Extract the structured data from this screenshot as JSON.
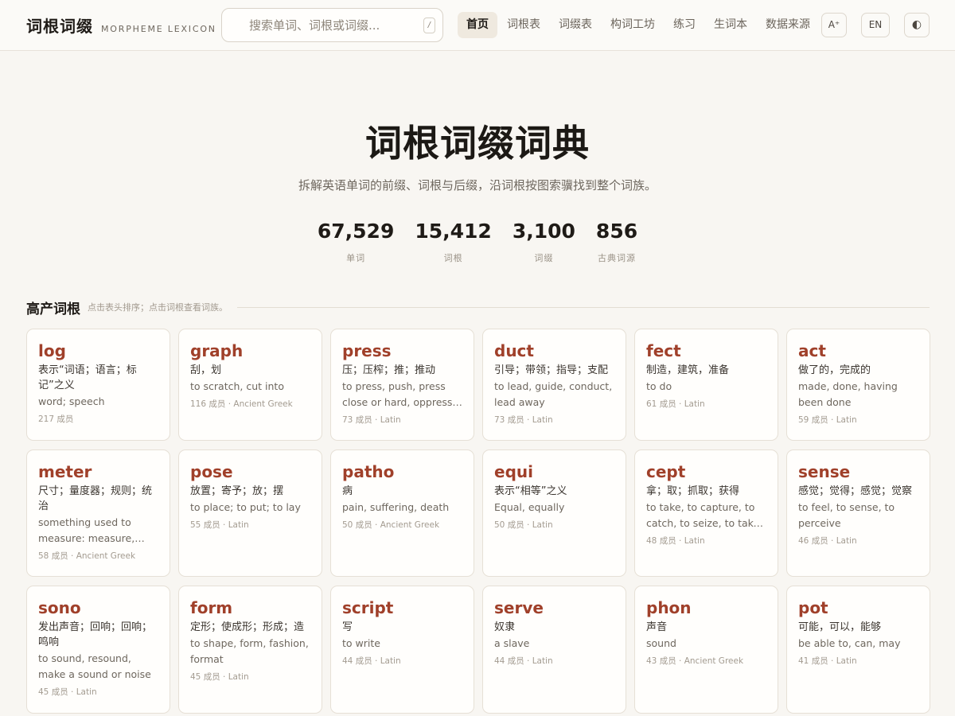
{
  "header": {
    "brand_cn": "词根词缀",
    "brand_en": "MORPHEME LEXICON",
    "search_placeholder": "搜索单词、词根或词缀...",
    "search_shortcut": "/",
    "nav": [
      "首页",
      "词根表",
      "词缀表",
      "构词工坊",
      "练习",
      "生词本",
      "数据来源"
    ],
    "active_nav": "首页",
    "font_size_label": "A⁺",
    "lang_label": "EN",
    "theme_icon": "◐"
  },
  "hero": {
    "title": "词根词缀词典",
    "subtitle": "拆解英语单词的前缀、词根与后缀，沿词根按图索骥找到整个词族。",
    "stats": [
      {
        "value": "67,529",
        "label": "单词"
      },
      {
        "value": "15,412",
        "label": "词根"
      },
      {
        "value": "3,100",
        "label": "词缀"
      },
      {
        "value": "856",
        "label": "古典词源"
      }
    ]
  },
  "section": {
    "title": "高产词根",
    "hint": "点击表头排序；点击词根查看词族。"
  },
  "cards": [
    {
      "root": "log",
      "cn": "表示“词语；语言；标记”之义",
      "en": "word; speech",
      "meta": "217 成员"
    },
    {
      "root": "graph",
      "cn": "刮，划",
      "en": "to scratch, cut into",
      "meta": "116 成员 · Ancient Greek"
    },
    {
      "root": "press",
      "cn": "压；压榨；推；推动",
      "en": "to press, push, press close or hard, oppress, urge",
      "meta": "73 成员 · Latin"
    },
    {
      "root": "duct",
      "cn": "引导；带领；指导；支配",
      "en": "to lead, guide, conduct, lead away",
      "meta": "73 成员 · Latin"
    },
    {
      "root": "fect",
      "cn": "制造，建筑，准备",
      "en": "to do",
      "meta": "61 成员 · Latin"
    },
    {
      "root": "act",
      "cn": "做了的，完成的",
      "en": "made, done, having been done",
      "meta": "59 成员 · Latin"
    },
    {
      "root": "meter",
      "cn": "尺寸；量度器；规则；统治",
      "en": "something used to measure: measure, rule, length",
      "meta": "58 成员 · Ancient Greek"
    },
    {
      "root": "pose",
      "cn": "放置；寄予；放；摆",
      "en": "to place; to put; to lay",
      "meta": "55 成员 · Latin"
    },
    {
      "root": "patho",
      "cn": "病",
      "en": "pain, suffering, death",
      "meta": "50 成员 · Ancient Greek"
    },
    {
      "root": "equi",
      "cn": "表示“相等”之义",
      "en": "Equal, equally",
      "meta": "50 成员 · Latin"
    },
    {
      "root": "cept",
      "cn": "拿；取；抓取；获得",
      "en": "to take, to capture, to catch, to seize, to take hold of",
      "meta": "48 成员 · Latin"
    },
    {
      "root": "sense",
      "cn": "感觉；觉得；感觉；觉察",
      "en": "to feel, to sense, to perceive",
      "meta": "46 成员 · Latin"
    },
    {
      "root": "sono",
      "cn": "发出声音；回响；回响；鸣响",
      "en": "to sound, resound, make a sound or noise",
      "meta": "45 成员 · Latin"
    },
    {
      "root": "form",
      "cn": "定形；使成形；形成；造",
      "en": "to shape, form, fashion, format",
      "meta": "45 成员 · Latin"
    },
    {
      "root": "script",
      "cn": "写",
      "en": "to write",
      "meta": "44 成员 · Latin"
    },
    {
      "root": "serve",
      "cn": "奴隶",
      "en": "a slave",
      "meta": "44 成员 · Latin"
    },
    {
      "root": "phon",
      "cn": "声音",
      "en": "sound",
      "meta": "43 成员 · Ancient Greek"
    },
    {
      "root": "pot",
      "cn": "可能，可以，能够",
      "en": "be able to, can, may",
      "meta": "41 成员 · Latin"
    }
  ]
}
